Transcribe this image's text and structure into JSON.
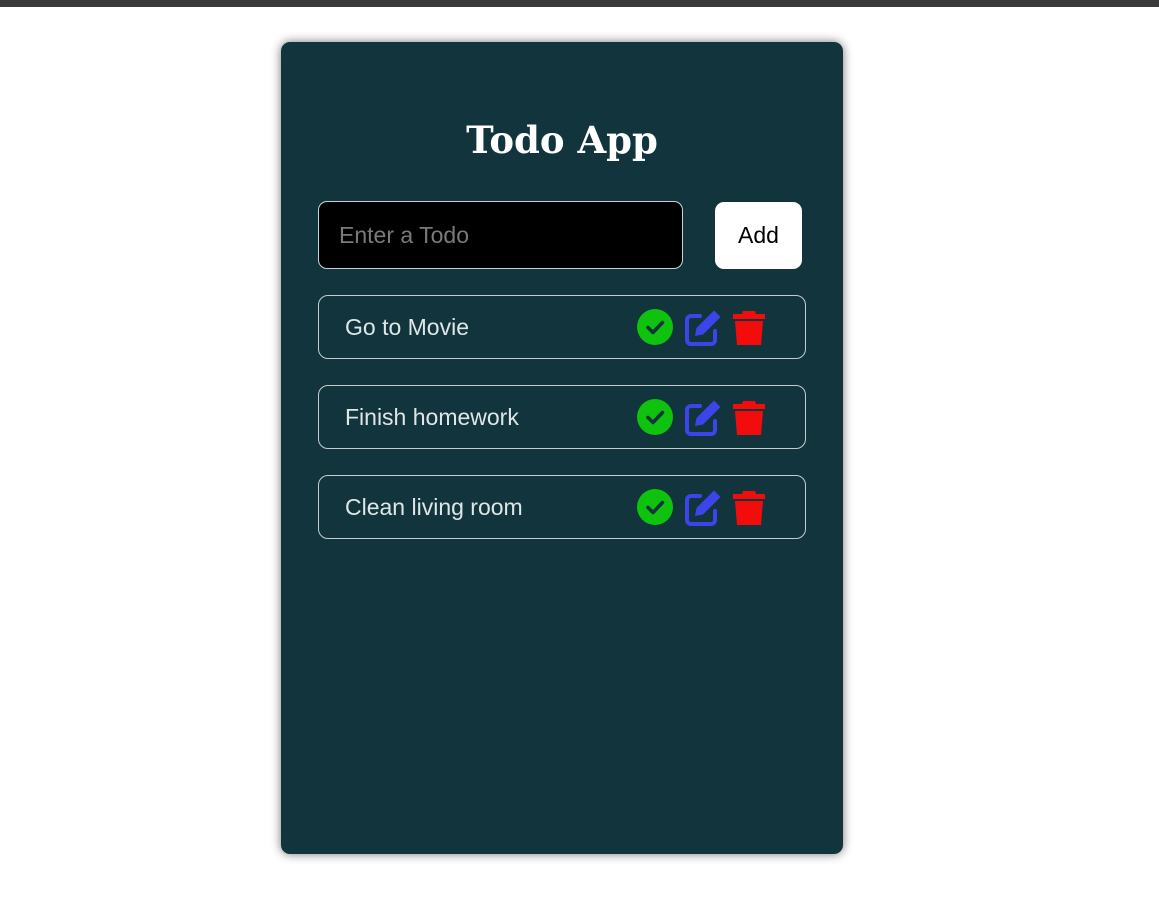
{
  "app": {
    "title": "Todo App"
  },
  "form": {
    "input_placeholder": "Enter a Todo",
    "input_value": "",
    "add_label": "Add"
  },
  "todos": [
    {
      "text": "Go to Movie"
    },
    {
      "text": "Finish homework"
    },
    {
      "text": "Clean living room"
    }
  ],
  "icons": {
    "complete": "check-circle-icon",
    "edit": "edit-icon",
    "delete": "trash-icon"
  },
  "colors": {
    "card_background": "#12353d",
    "complete_icon": "#0ec20e",
    "edit_icon": "#3c44ea",
    "delete_icon": "#f20c0c"
  }
}
